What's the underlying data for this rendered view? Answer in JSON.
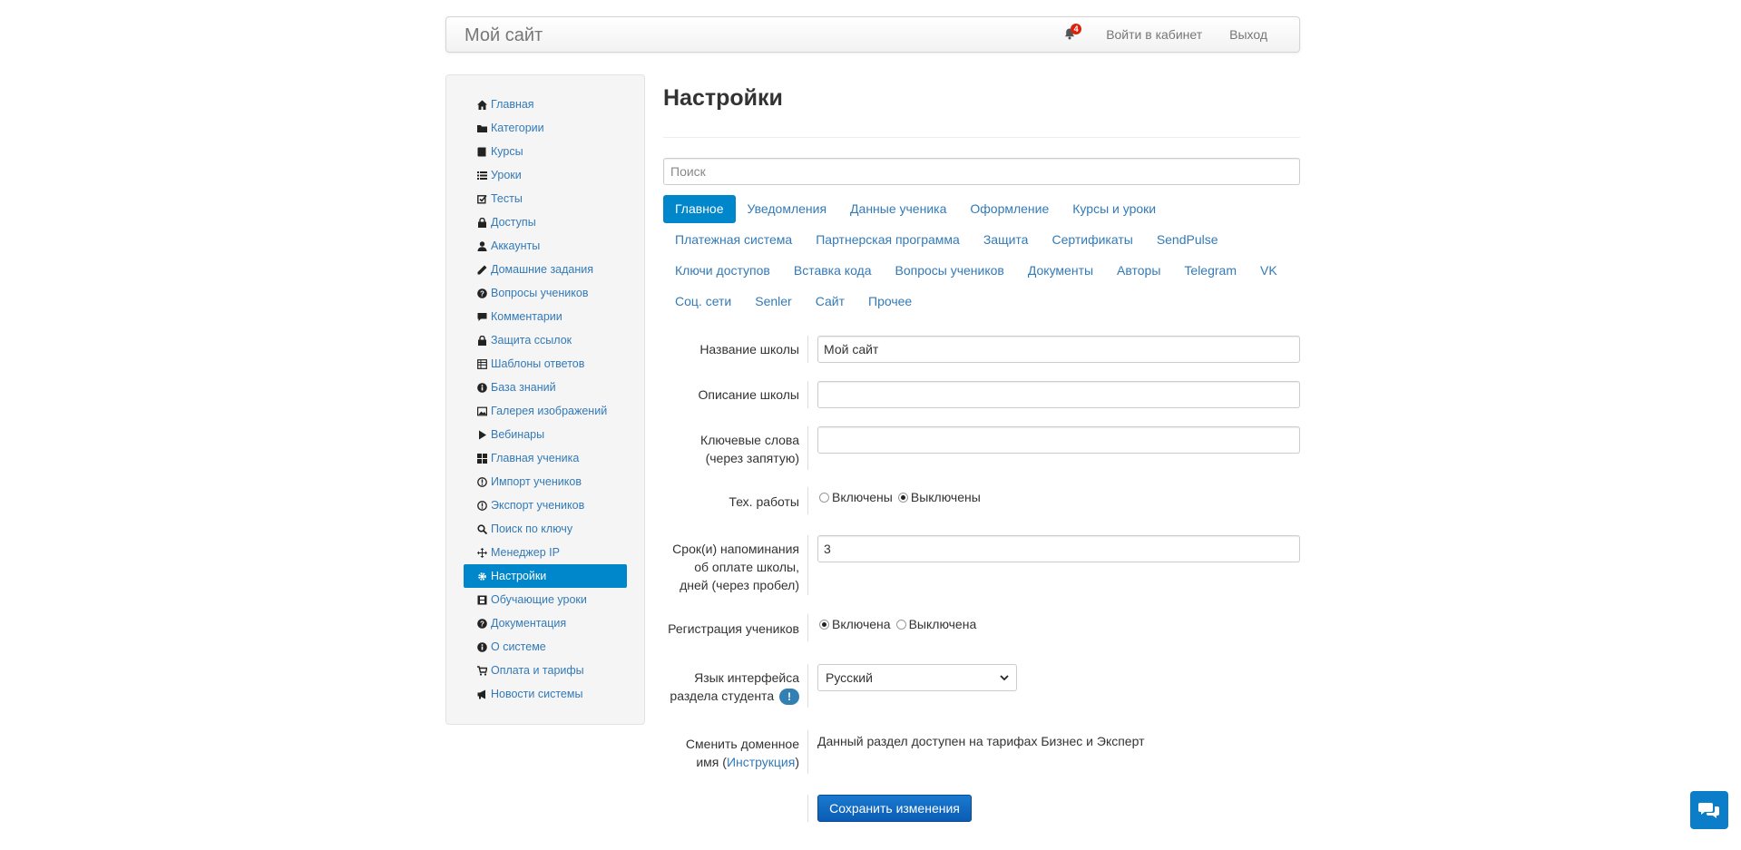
{
  "header": {
    "brand": "Мой сайт",
    "notification_count": "4",
    "login_label": "Войти в кабинет",
    "logout_label": "Выход"
  },
  "sidebar": {
    "items": [
      {
        "label": "Главная",
        "icon": "home-icon"
      },
      {
        "label": "Категории",
        "icon": "folder-icon"
      },
      {
        "label": "Курсы",
        "icon": "book-icon"
      },
      {
        "label": "Уроки",
        "icon": "list-icon"
      },
      {
        "label": "Тесты",
        "icon": "edit-check-icon"
      },
      {
        "label": "Доступы",
        "icon": "lock-icon"
      },
      {
        "label": "Аккаунты",
        "icon": "user-icon"
      },
      {
        "label": "Домашние задания",
        "icon": "pencil-icon"
      },
      {
        "label": "Вопросы учеников",
        "icon": "question-circle-icon"
      },
      {
        "label": "Комментарии",
        "icon": "comment-icon"
      },
      {
        "label": "Защита ссылок",
        "icon": "lock-icon"
      },
      {
        "label": "Шаблоны ответов",
        "icon": "table-icon"
      },
      {
        "label": "База знаний",
        "icon": "info-circle-icon"
      },
      {
        "label": "Галерея изображений",
        "icon": "picture-icon"
      },
      {
        "label": "Вебинары",
        "icon": "play-icon"
      },
      {
        "label": "Главная ученика",
        "icon": "dashboard-icon"
      },
      {
        "label": "Импорт учеников",
        "icon": "exclamation-circle-icon"
      },
      {
        "label": "Экспорт учеников",
        "icon": "exclamation-circle-icon"
      },
      {
        "label": "Поиск по ключу",
        "icon": "search-icon"
      },
      {
        "label": "Менеджер IP",
        "icon": "move-icon"
      },
      {
        "label": "Настройки",
        "icon": "gear-icon",
        "active": true
      },
      {
        "label": "Обучающие уроки",
        "icon": "film-icon"
      },
      {
        "label": "Документация",
        "icon": "question-circle-icon"
      },
      {
        "label": "О системе",
        "icon": "info-circle-icon"
      },
      {
        "label": "Оплата и тарифы",
        "icon": "cart-icon"
      },
      {
        "label": "Новости системы",
        "icon": "bullhorn-icon"
      }
    ]
  },
  "main": {
    "title": "Настройки",
    "search_placeholder": "Поиск",
    "tab_rows": [
      [
        "Главное",
        "Уведомления",
        "Данные ученика",
        "Оформление",
        "Курсы и уроки"
      ],
      [
        "Платежная система",
        "Партнерская программа",
        "Защита",
        "Сертификаты",
        "SendPulse"
      ],
      [
        "Ключи доступов",
        "Вставка кода",
        "Вопросы учеников",
        "Документы",
        "Авторы",
        "Telegram",
        "VK"
      ],
      [
        "Соц. сети",
        "Senler",
        "Сайт",
        "Прочее"
      ]
    ],
    "active_tab": "Главное",
    "form": {
      "school_name_label": "Название школы",
      "school_name_value": "Мой сайт",
      "school_desc_label": "Описание школы",
      "school_desc_value": "",
      "keywords_label_1": "Ключевые слова",
      "keywords_label_2": "(через запятую)",
      "keywords_value": "",
      "maintenance_label": "Тех. работы",
      "maintenance_on": "Включены",
      "maintenance_off": "Выключены",
      "reminder_label_1": "Срок(и) напоминания",
      "reminder_label_2": "об оплате школы,",
      "reminder_label_3": "дней (через пробел)",
      "reminder_value": "3",
      "registration_label": "Регистрация учеников",
      "registration_on": "Включена",
      "registration_off": "Выключена",
      "language_label_1": "Язык интерфейса",
      "language_label_2": "раздела студента",
      "language_badge": "!",
      "language_value": "Русский",
      "domain_label_1": "Сменить доменное",
      "domain_label_2": "имя (",
      "domain_link": "Инструкция",
      "domain_label_3": ")",
      "domain_text": "Данный раздел доступен на тарифах Бизнес и Эксперт",
      "save_label": "Сохранить изменения"
    }
  },
  "colors": {
    "accent": "#0086cb",
    "link": "#337ab7",
    "badge": "#d9230f",
    "save_button": "#0a5cb4"
  }
}
